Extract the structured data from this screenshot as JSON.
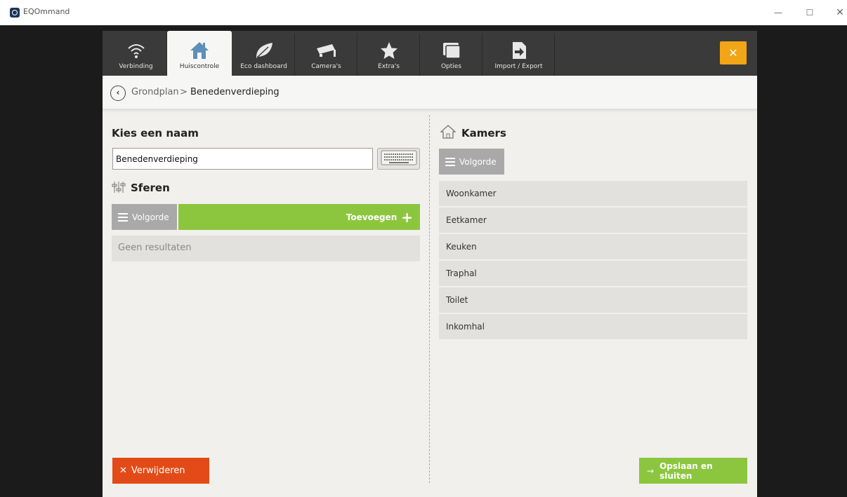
{
  "window": {
    "title": "EQOmmand",
    "minimize": "—",
    "maximize": "☐",
    "close": "✕"
  },
  "tabs": [
    {
      "label": "Verbinding",
      "icon": "wifi-icon",
      "active": false
    },
    {
      "label": "Huiscontrole",
      "icon": "house-icon",
      "active": true
    },
    {
      "label": "Eco dashboard",
      "icon": "leaf-icon",
      "active": false
    },
    {
      "label": "Camera's",
      "icon": "camera-icon",
      "active": false
    },
    {
      "label": "Extra's",
      "icon": "star-icon",
      "active": false
    },
    {
      "label": "Opties",
      "icon": "options-icon",
      "active": false
    },
    {
      "label": "Import / Export",
      "icon": "import-export-icon",
      "active": false
    }
  ],
  "close_app": "✕",
  "breadcrumb": {
    "back": "‹",
    "parent": "Grondplan",
    "separator": ">",
    "current": "Benedenverdieping"
  },
  "name_section": {
    "title": "Kies een naam",
    "value": "Benedenverdieping"
  },
  "spheres": {
    "title": "Sferen",
    "order_label": "Volgorde",
    "add_label": "Toevoegen",
    "add_icon": "+",
    "empty_text": "Geen resultaten"
  },
  "rooms": {
    "title": "Kamers",
    "order_label": "Volgorde",
    "items": [
      "Woonkamer",
      "Eetkamer",
      "Keuken",
      "Traphal",
      "Toilet",
      "Inkomhal"
    ]
  },
  "actions": {
    "delete_label": "Verwijderen",
    "delete_icon": "✕",
    "save_label": "Opslaan en sluiten",
    "save_icon": "→"
  },
  "colors": {
    "accent_green": "#8cc63f",
    "accent_orange": "#f2a516",
    "danger": "#e24b17",
    "tabbar": "#3a3a3a"
  }
}
